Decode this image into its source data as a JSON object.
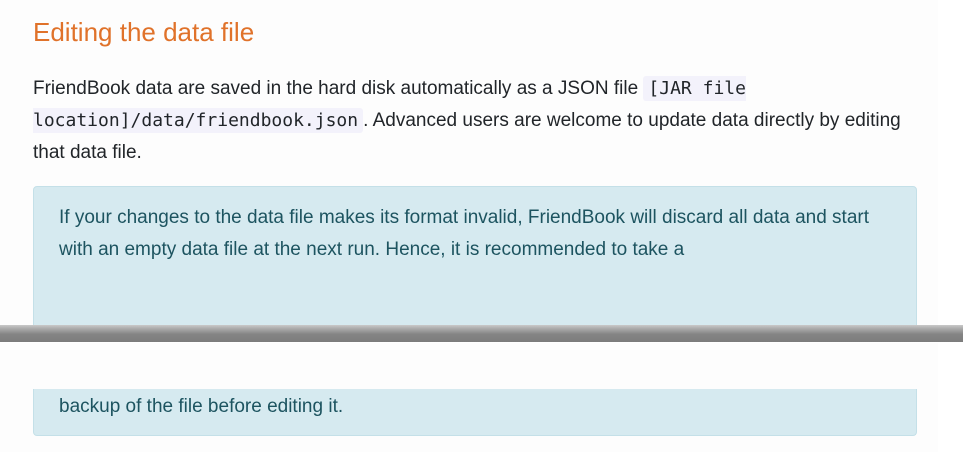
{
  "section": {
    "heading": "Editing the data file",
    "paragraph": {
      "text_before": "FriendBook data are saved in the hard disk automatically as a JSON file ",
      "code_path": "[JAR file location]/data/friendbook.json",
      "text_after": ". Advanced users are welcome to update data directly by editing that data file."
    },
    "callout": {
      "text_part1": "If your changes to the data file makes its format invalid, FriendBook will discard all data and start with an empty data file at the next run. Hence, it is recommended to take a",
      "text_part2": "backup of the file before editing it."
    }
  },
  "colors": {
    "heading": "#e0722a",
    "callout_background": "#d6eaf0",
    "callout_text": "#1d5460",
    "code_background": "#f3f2fb"
  }
}
